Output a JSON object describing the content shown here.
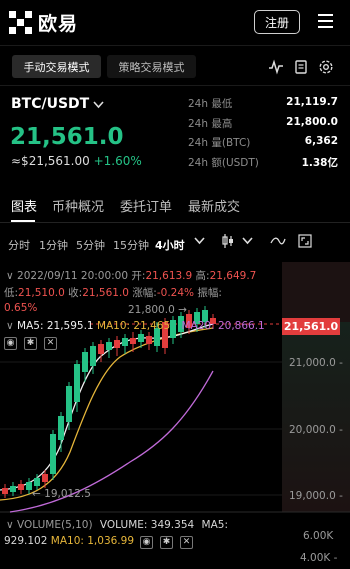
{
  "header": {
    "logo_text": "欧易",
    "register_label": "注册"
  },
  "mode_tabs": {
    "manual": "手动交易模式",
    "strategy": "策略交易模式"
  },
  "ticker": {
    "pair": "BTC/USDT",
    "price": "21,561.0",
    "fiat": "≈$21,561.00",
    "change": "+1.60%",
    "stats": [
      {
        "label": "24h 最低",
        "value": "21,119.7"
      },
      {
        "label": "24h 最高",
        "value": "21,800.0"
      },
      {
        "label": "24h 量(BTC)",
        "value": "6,362"
      },
      {
        "label": "24h 额(USDT)",
        "value": "1.38亿"
      }
    ]
  },
  "section_tabs": [
    "图表",
    "币种概况",
    "委托订单",
    "最新成交"
  ],
  "intervals": [
    "分时",
    "1分钟",
    "5分钟",
    "15分钟",
    "4小时"
  ],
  "chart_info": {
    "datetime": "2022/09/11 20:00:00",
    "open_label": "开:",
    "open": "21,613.9",
    "high_label": "高:",
    "high": "21,649.7",
    "low_label": "低:",
    "low": "21,510.0",
    "close_label": "收:",
    "close": "21,561.0",
    "chg_label": "涨幅:",
    "chg": "-0.24%",
    "amp_label": "振幅:",
    "amp": "0.65%",
    "ma5": "MA5: 21,595.1",
    "ma10": "MA10: 21,465",
    "ma20": "MA20: 20,866.1",
    "high_marker": "21,800.0 →",
    "low_marker": "← 19,012.5",
    "last_price": "21,561.0",
    "y_labels": [
      "21,000.0 -",
      "20,000.0 -",
      "19,000.0 -"
    ],
    "vol_label": "VOLUME(5,10)",
    "vol_value": "VOLUME: 349.354",
    "vol_ma5_label": "MA5:",
    "vol_ma5": "929.102",
    "vol_ma10": "MA10: 1,036.99",
    "vol_y_labels": [
      "6.00K",
      "4.00K -"
    ]
  },
  "colors": {
    "up": "#25c286",
    "down": "#e23d3d",
    "ma5": "#f0f0f0",
    "ma10": "#e6b63a",
    "ma20": "#c06ad8"
  },
  "icons": [
    "okx-logo-icon",
    "menu-icon",
    "pulse-icon",
    "notes-icon",
    "settings-icon",
    "chevron-down-icon",
    "candle-type-icon",
    "line-indicator-icon",
    "fullscreen-icon",
    "eye-icon",
    "gear-icon",
    "close-icon"
  ]
}
